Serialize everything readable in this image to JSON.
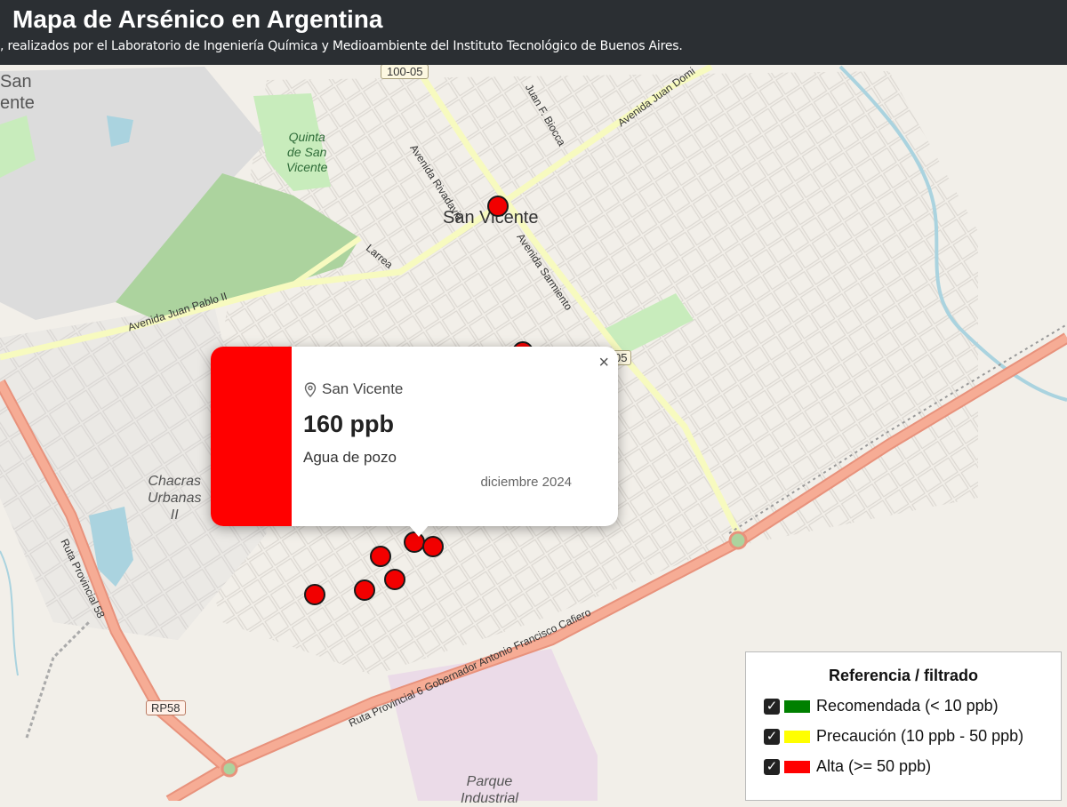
{
  "header": {
    "title": "Mapa de Arsénico en Argentina",
    "subtitle": ", realizados por el Laboratorio de Ingeniería Química y Medioambiente del Instituto Tecnológico de Buenos Aires."
  },
  "map": {
    "labels": {
      "city": "San Vicente",
      "quinta": [
        "Quinta",
        "de San",
        "Vicente"
      ],
      "chacras": [
        "Chacras",
        "Urbanas",
        "II"
      ],
      "parque": [
        "Parque",
        "Industrial"
      ],
      "corner_city": [
        "San",
        "ente"
      ],
      "road_100_05": "100-05",
      "road_05": "05",
      "road_rp58": "RP58",
      "av_rivadavia": "Avenida Rivadavia",
      "av_juan_domingo": "Avenida Juan Domi",
      "juan_f_biocca": "Juan F. Biocca",
      "av_sarmiento": "Avenida Sarmiento",
      "larrea": "Larrea",
      "av_juan_pablo": "Avenida Juan Pablo II",
      "ruta_58": "Ruta Provincial 58",
      "ruta_6": "Ruta Provincial 6 Gobernador Antonio Francisco Cafiero"
    },
    "colors": {
      "alta": "#ff0000",
      "precaucion": "#ffff00",
      "recomendada": "#008000"
    }
  },
  "popup": {
    "location": "San Vicente",
    "value": "160 ppb",
    "source": "Agua de pozo",
    "date": "diciembre 2024",
    "close_icon": "×"
  },
  "legend": {
    "title": "Referencia / filtrado",
    "items": [
      {
        "label": "Recomendada (< 10 ppb)",
        "color": "#008000",
        "checked": true
      },
      {
        "label": "Precaución (10 ppb - 50 ppb)",
        "color": "#ffff00",
        "checked": true
      },
      {
        "label": "Alta (>= 50 ppb)",
        "color": "#ff0000",
        "checked": true
      }
    ]
  }
}
